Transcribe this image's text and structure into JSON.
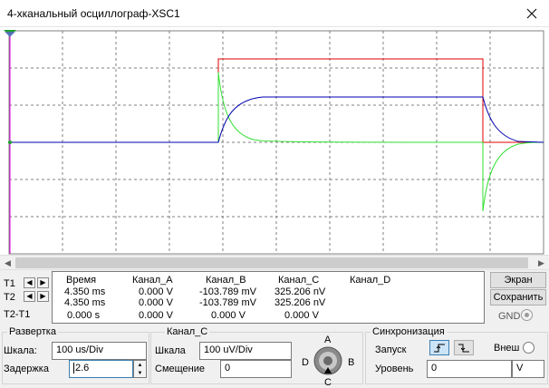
{
  "window": {
    "title": "4-хканальный осциллограф-XSC1"
  },
  "cursors": {
    "t1_label": "T1",
    "t2_label": "T2",
    "dt_label": "T2-T1",
    "headers": {
      "time": "Время",
      "a": "Канал_A",
      "b": "Канал_B",
      "c": "Канал_C",
      "d": "Канал_D"
    },
    "rows": [
      {
        "time": "4.350 ms",
        "a": "0.000 V",
        "b": "-103.789 mV",
        "c": "325.206 nV",
        "d": ""
      },
      {
        "time": "4.350 ms",
        "a": "0.000 V",
        "b": "-103.789 mV",
        "c": "325.206 nV",
        "d": ""
      },
      {
        "time": "0.000 s",
        "a": "0.000 V",
        "b": "0.000 V",
        "c": "0.000 V",
        "d": ""
      }
    ]
  },
  "buttons": {
    "screen": "Экран",
    "save": "Сохранить",
    "gnd": "GND"
  },
  "timebase": {
    "title": "Развертка",
    "scale_label": "Шкала:",
    "scale_value": "100 us/Div",
    "delay_label": "Задержка",
    "delay_value": "2.6"
  },
  "channel": {
    "title": "Канал_C",
    "scale_label": "Шкала",
    "scale_value": "100 uV/Div",
    "offset_label": "Смещение",
    "offset_value": "0",
    "knob": {
      "a": "A",
      "b": "B",
      "c": "C",
      "d": "D"
    }
  },
  "trigger": {
    "title": "Синхронизация",
    "start_label": "Запуск",
    "ext_label": "Внеш",
    "level_label": "Уровень",
    "level_value": "0",
    "level_unit": "V"
  },
  "colors": {
    "grid": "#808080",
    "channel_a": "#e00000",
    "channel_b": "#30e030",
    "channel_c": "#0000b0",
    "cursor_t1": "#e000e0",
    "cursor_marker": "#20a030"
  },
  "icons": {
    "close": "close-icon",
    "scroll_left": "arrow-left-icon",
    "scroll_right": "arrow-right-icon",
    "rising_edge": "rising-edge-icon",
    "falling_edge": "falling-edge-icon",
    "knob": "channel-selector-knob-icon"
  }
}
